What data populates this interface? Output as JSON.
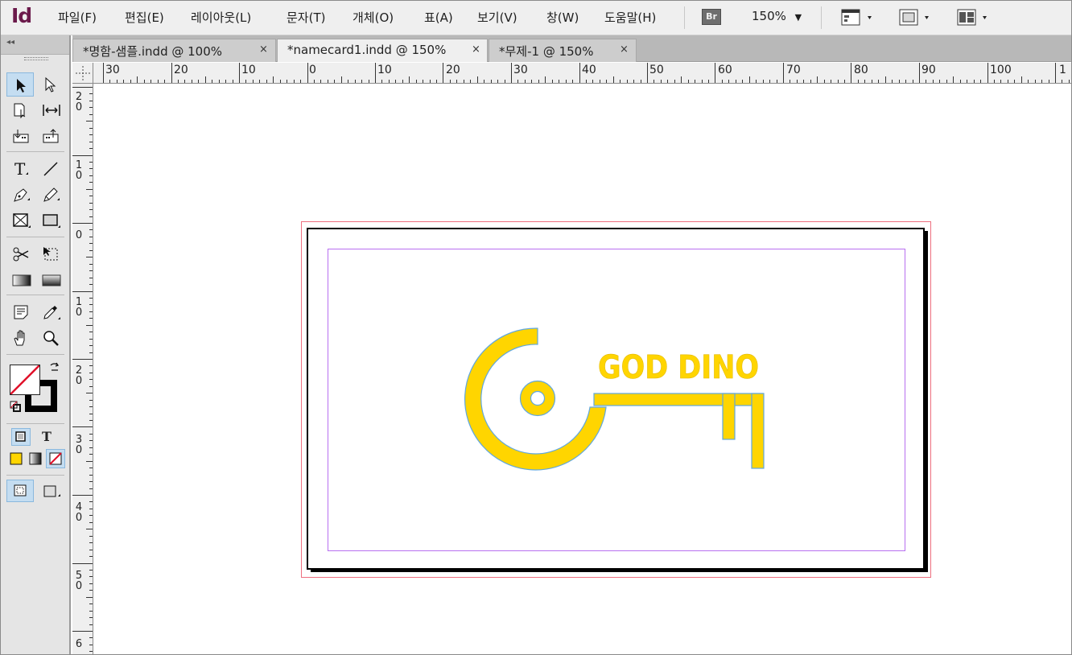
{
  "app": {
    "logo_text": "Id"
  },
  "menu": {
    "items": [
      "파일(F)",
      "편집(E)",
      "레이아웃(L)",
      "문자(T)",
      "개체(O)",
      "표(A)",
      "보기(V)",
      "창(W)",
      "도움말(H)"
    ],
    "bridge_label": "Br",
    "zoom_value": "150%",
    "zoom_arrow": "▼",
    "icons": [
      "view-options-icon",
      "screen-mode-icon",
      "arrange-documents-icon"
    ]
  },
  "tools_panel": {
    "collapse_glyph": "◂◂",
    "tools": [
      "selection-tool-icon",
      "direct-selection-tool-icon",
      "page-tool-icon",
      "gap-tool-icon",
      "content-collector-icon",
      "content-placer-icon",
      "type-tool-icon",
      "line-tool-icon",
      "pen-tool-icon",
      "pencil-tool-icon",
      "rectangle-frame-tool-icon",
      "rectangle-tool-icon",
      "scissors-tool-icon",
      "free-transform-tool-icon",
      "gradient-swatch-tool-icon",
      "gradient-feather-tool-icon",
      "note-tool-icon",
      "eyedropper-tool-icon",
      "hand-tool-icon",
      "zoom-tool-icon",
      "formatting-affects-container-icon",
      "formatting-affects-text-icon",
      "apply-color-icon",
      "apply-gradient-icon",
      "apply-none-icon",
      "normal-view-icon",
      "screen-mode-icon"
    ],
    "formatting_text_glyph": "T"
  },
  "tabs": [
    {
      "label": "*명함-샘플.indd @ 100%",
      "close": "×",
      "active": false
    },
    {
      "label": "*namecard1.indd @ 150%",
      "close": "×",
      "active": true
    },
    {
      "label": "*무제-1 @ 150%",
      "close": "×",
      "active": false
    }
  ],
  "ruler": {
    "horizontal_labels": [
      "30",
      "20",
      "10",
      "0",
      "10",
      "20",
      "30",
      "40",
      "50",
      "60",
      "70",
      "80",
      "90",
      "100",
      "1"
    ],
    "vertical_labels": [
      [
        "2",
        "0"
      ],
      [
        "1",
        "0"
      ],
      [
        "0"
      ],
      [
        "1",
        "0"
      ],
      [
        "2",
        "0"
      ],
      [
        "3",
        "0"
      ],
      [
        "4",
        "0"
      ],
      [
        "5",
        "0"
      ],
      [
        "6"
      ]
    ]
  },
  "document": {
    "logo_wordmark": "GOD DINO",
    "colors": {
      "logo_fill": "#ffd500",
      "logo_outline": "#5fa7e0",
      "bleed_guide": "#ee6f7f",
      "margin_guide": "#b86ff0"
    }
  }
}
